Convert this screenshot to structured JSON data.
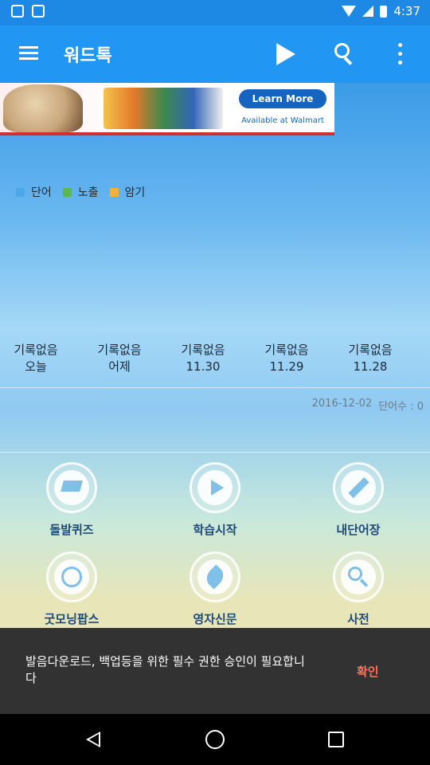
{
  "status_bar": {
    "time": "4:37"
  },
  "app_bar": {
    "title": "워드톡"
  },
  "ad": {
    "learn_more": "Learn More",
    "available": "Available at Walmart"
  },
  "legend": [
    {
      "label": "단어",
      "color": "#4aa8e6"
    },
    {
      "label": "노출",
      "color": "#5db84a"
    },
    {
      "label": "암기",
      "color": "#f2b23a"
    }
  ],
  "days": [
    {
      "status": "기록없음",
      "date": "오늘"
    },
    {
      "status": "기록없음",
      "date": "어제"
    },
    {
      "status": "기록없음",
      "date": "11.30"
    },
    {
      "status": "기록없음",
      "date": "11.29"
    },
    {
      "status": "기록없음",
      "date": "11.28"
    }
  ],
  "info": {
    "date": "2016-12-02",
    "word_count": "단어수 : 0"
  },
  "menu": [
    {
      "label": "돌발퀴즈",
      "icon": "graduation-cap-icon"
    },
    {
      "label": "학습시작",
      "icon": "play-icon"
    },
    {
      "label": "내단어장",
      "icon": "pencil-icon"
    },
    {
      "label": "굿모닝팝스",
      "icon": "globe-icon"
    },
    {
      "label": "영자신문",
      "icon": "leaf-icon"
    },
    {
      "label": "사전",
      "icon": "search-icon"
    }
  ],
  "snackbar": {
    "message": "발음다운로드, 백업등을 위한 필수 권한 승인이 필요합니다",
    "action": "확인"
  }
}
